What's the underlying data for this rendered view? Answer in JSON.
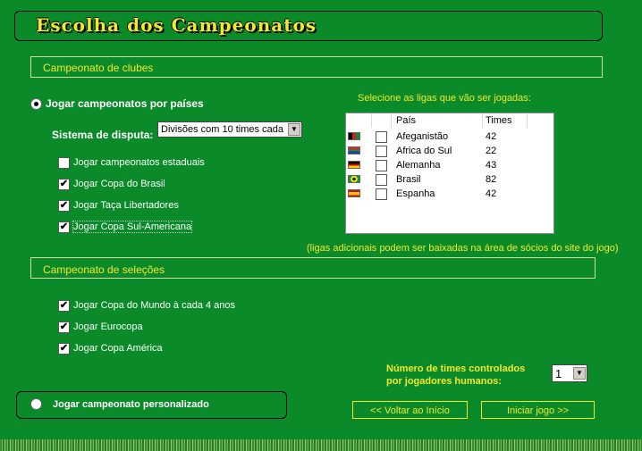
{
  "title": "Escolha dos Campeonatos",
  "clubs_section": {
    "label": "Campeonato de clubes"
  },
  "countries_option": {
    "label": "Jogar campeonatos por países",
    "selected": true
  },
  "dispute": {
    "label": "Sistema de disputa:",
    "value": "Divisões com 10 times cada"
  },
  "club_options": [
    {
      "label": "Jogar campeonatos estaduais",
      "checked": false
    },
    {
      "label": "Jogar Copa do Brasil",
      "checked": true
    },
    {
      "label": "Jogar Taça Libertadores",
      "checked": true
    },
    {
      "label": "Jogar Copa Sul-Americana",
      "checked": true
    }
  ],
  "leagues": {
    "prompt": "Selecione as ligas que vão ser jogadas:",
    "col_country": "País",
    "col_teams": "Times",
    "rows": [
      {
        "country": "Afeganistão",
        "teams": "42",
        "checked": false,
        "flag_colors": [
          "#000000",
          "#cc2222",
          "#118833"
        ]
      },
      {
        "country": "Africa do Sul",
        "teams": "22",
        "checked": false,
        "flag_colors": [
          "#d62828",
          "#1f8a3a",
          "#1d3f9c"
        ]
      },
      {
        "country": "Alemanha",
        "teams": "43",
        "checked": false,
        "flag_colors": [
          "#000000",
          "#dd0000",
          "#ffce00"
        ]
      },
      {
        "country": "Brasil",
        "teams": "82",
        "checked": false,
        "flag_colors": [
          "#009c3b",
          "#ffdf00",
          "#002776"
        ]
      },
      {
        "country": "Espanha",
        "teams": "42",
        "checked": false,
        "flag_colors": [
          "#c60b1e",
          "#ffc400",
          "#c60b1e"
        ]
      }
    ],
    "note": "(ligas adicionais podem ser baixadas na área de sócios do site do jogo)"
  },
  "selections_section": {
    "label": "Campeonato de seleções"
  },
  "selection_options": [
    {
      "label": "Jogar Copa do Mundo à cada 4 anos",
      "checked": true
    },
    {
      "label": "Jogar Eurocopa",
      "checked": true
    },
    {
      "label": "Jogar Copa América",
      "checked": true
    }
  ],
  "human_players": {
    "label_line1": "Número de times controlados",
    "label_line2": "por jogadores humanos:",
    "value": "1"
  },
  "custom_option": {
    "label": "Jogar campeonato personalizado",
    "selected": false
  },
  "buttons": {
    "back": "<< Voltar ao Início",
    "start": "Iniciar jogo >>"
  },
  "colors": {
    "background": "#0b8a2a",
    "accent": "#f3e92c"
  }
}
